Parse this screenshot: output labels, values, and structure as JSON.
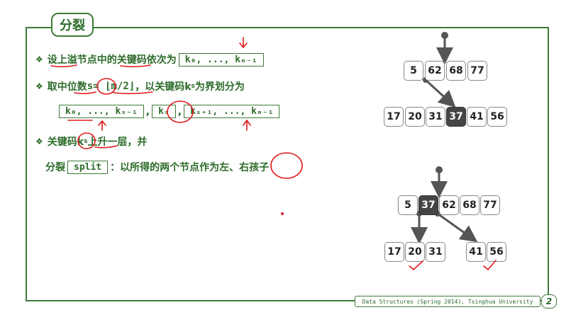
{
  "slide": {
    "title": "分裂",
    "bullet_symbol": "❖",
    "line1": {
      "text": "设上溢节点中的关键码依次为",
      "box": "k₀, ..., kₘ₋₁"
    },
    "line2": {
      "text_a": "取中位数",
      "s": "s",
      "eq": " = ⌊m/2⌋",
      "text_b": "，以关键码k",
      "sub": "s",
      "text_c": "为界划分为"
    },
    "line3": {
      "box1": "k₀, ..., kₛ₋₁",
      "comma1": ",",
      "box2": "kₛ",
      "comma2": ",",
      "box3": "kₛ₊₁, ..., kₘ₋₁"
    },
    "line4": {
      "text_a": "关键码k",
      "sub": "s",
      "text_b": "上升一层，并"
    },
    "line5": {
      "text_a": "分裂",
      "code": "split",
      "text_b": "：以所得的两个节点作为左、右孩子"
    }
  },
  "tree_top": {
    "parent": [
      "5",
      "62",
      "68",
      "77"
    ],
    "overflow": [
      "17",
      "20",
      "31",
      "37",
      "41",
      "56"
    ]
  },
  "tree_bottom": {
    "parent": [
      "5",
      "37",
      "62",
      "68",
      "77"
    ],
    "left_child": [
      "17",
      "20",
      "31"
    ],
    "right_child": [
      "41",
      "56"
    ]
  },
  "footer": {
    "course": "Data Structures (Spring 2014), Tsinghua University",
    "page": "2"
  },
  "colors": {
    "accent": "#2c6b2a",
    "border": "#3e7a37",
    "ink": "#e0191b",
    "dark_cell": "#444444"
  }
}
